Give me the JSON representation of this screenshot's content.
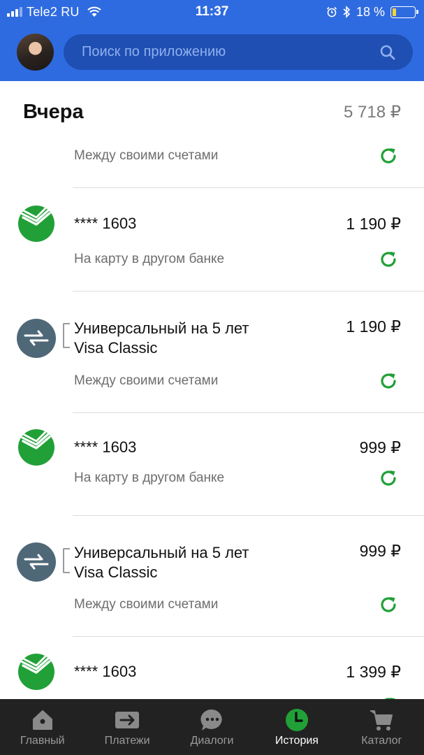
{
  "status_bar": {
    "carrier": "Tele2 RU",
    "time": "11:37",
    "battery_percent": "18 %",
    "battery_level": 0.18
  },
  "header": {
    "search_placeholder": "Поиск по приложению"
  },
  "history": {
    "day_title": "Вчера",
    "day_total": "5 718 ₽",
    "items": [
      {
        "title": "",
        "title2": "",
        "subtitle": "Между своими счетами",
        "amount": "",
        "icon": "transfer-icon"
      },
      {
        "title": "**** 1603",
        "title2": "",
        "subtitle": "На карту в другом банке",
        "amount": "1 190 ₽",
        "icon": "sberbank-logo-icon"
      },
      {
        "title": "Универсальный на 5 лет",
        "title2": "Visa Classic",
        "subtitle": "Между своими счетами",
        "amount": "1 190 ₽",
        "icon": "transfer-icon"
      },
      {
        "title": "**** 1603",
        "title2": "",
        "subtitle": "На карту в другом банке",
        "amount": "999 ₽",
        "icon": "sberbank-logo-icon"
      },
      {
        "title": "Универсальный на 5 лет",
        "title2": "Visa Classic",
        "subtitle": "Между своими счетами",
        "amount": "999 ₽",
        "icon": "transfer-icon"
      },
      {
        "title": "**** 1603",
        "title2": "",
        "subtitle": "",
        "amount": "1 399 ₽",
        "icon": "sberbank-logo-icon"
      }
    ]
  },
  "tabbar": {
    "tabs": [
      {
        "label": "Главный",
        "icon": "home-icon",
        "active": false
      },
      {
        "label": "Платежи",
        "icon": "payments-icon",
        "active": false
      },
      {
        "label": "Диалоги",
        "icon": "chat-icon",
        "active": false
      },
      {
        "label": "История",
        "icon": "clock-icon",
        "active": true
      },
      {
        "label": "Каталог",
        "icon": "cart-icon",
        "active": false
      }
    ]
  },
  "colors": {
    "brand_blue": "#2f6be0",
    "search_bg": "#1f4fb3",
    "sber_green": "#21a038",
    "transfer_circle": "#4f6878",
    "tabbar_bg": "#222222"
  }
}
